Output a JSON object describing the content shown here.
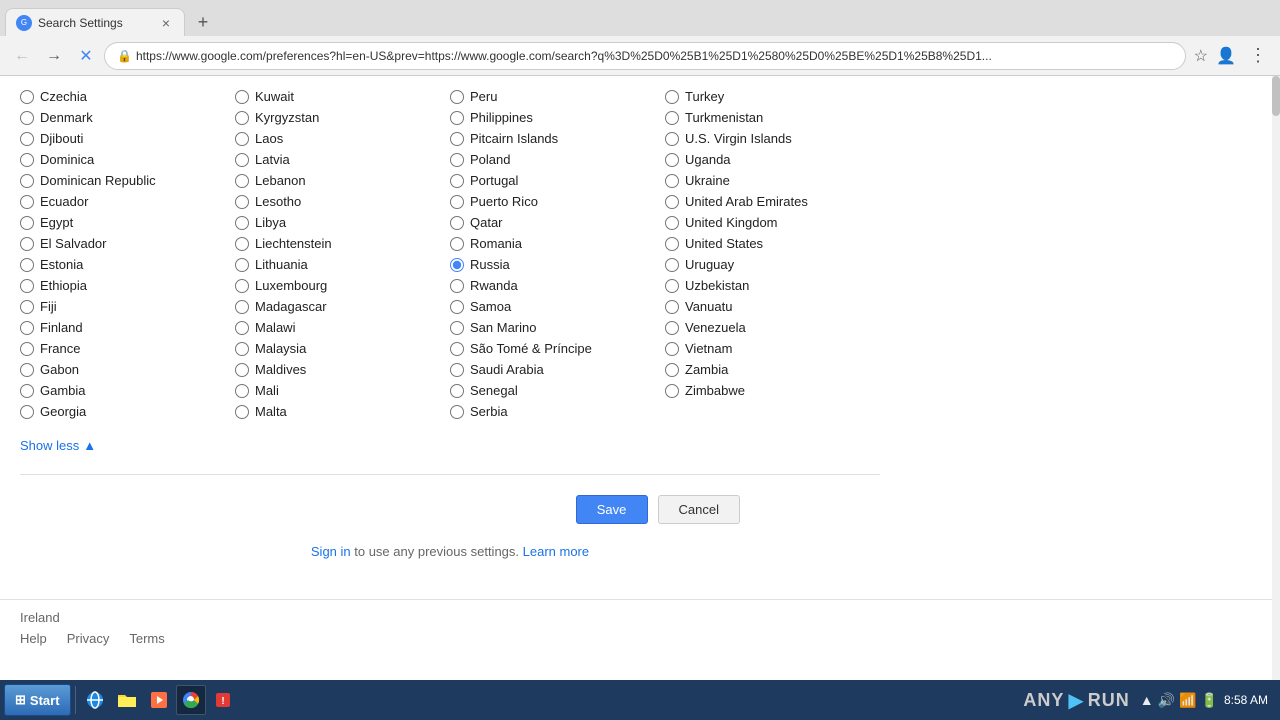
{
  "browser": {
    "tab_title": "Search Settings",
    "url": "https://www.google.com/preferences?hl=en-US&prev=https://www.google.com/search?q%3D%25D0%25B1%25D1%2580%25D0%25BE%25D1%25B8%25D1...",
    "favicon_text": "G"
  },
  "countries": {
    "col1": [
      {
        "id": "czechia",
        "label": "Czechia",
        "checked": false
      },
      {
        "id": "denmark",
        "label": "Denmark",
        "checked": false
      },
      {
        "id": "djibouti",
        "label": "Djibouti",
        "checked": false
      },
      {
        "id": "dominica",
        "label": "Dominica",
        "checked": false
      },
      {
        "id": "dominican_republic",
        "label": "Dominican Republic",
        "checked": false
      },
      {
        "id": "ecuador",
        "label": "Ecuador",
        "checked": false
      },
      {
        "id": "egypt",
        "label": "Egypt",
        "checked": false
      },
      {
        "id": "el_salvador",
        "label": "El Salvador",
        "checked": false
      },
      {
        "id": "estonia",
        "label": "Estonia",
        "checked": false
      },
      {
        "id": "ethiopia",
        "label": "Ethiopia",
        "checked": false
      },
      {
        "id": "fiji",
        "label": "Fiji",
        "checked": false
      },
      {
        "id": "finland",
        "label": "Finland",
        "checked": false
      },
      {
        "id": "france",
        "label": "France",
        "checked": false
      },
      {
        "id": "gabon",
        "label": "Gabon",
        "checked": false
      },
      {
        "id": "gambia",
        "label": "Gambia",
        "checked": false
      },
      {
        "id": "georgia",
        "label": "Georgia",
        "checked": false
      }
    ],
    "col2": [
      {
        "id": "kuwait",
        "label": "Kuwait",
        "checked": false
      },
      {
        "id": "kyrgyzstan",
        "label": "Kyrgyzstan",
        "checked": false
      },
      {
        "id": "laos",
        "label": "Laos",
        "checked": false
      },
      {
        "id": "latvia",
        "label": "Latvia",
        "checked": false
      },
      {
        "id": "lebanon",
        "label": "Lebanon",
        "checked": false
      },
      {
        "id": "lesotho",
        "label": "Lesotho",
        "checked": false
      },
      {
        "id": "libya",
        "label": "Libya",
        "checked": false
      },
      {
        "id": "liechtenstein",
        "label": "Liechtenstein",
        "checked": false
      },
      {
        "id": "lithuania",
        "label": "Lithuania",
        "checked": false
      },
      {
        "id": "luxembourg",
        "label": "Luxembourg",
        "checked": false
      },
      {
        "id": "madagascar",
        "label": "Madagascar",
        "checked": false
      },
      {
        "id": "malawi",
        "label": "Malawi",
        "checked": false
      },
      {
        "id": "malaysia",
        "label": "Malaysia",
        "checked": false
      },
      {
        "id": "maldives",
        "label": "Maldives",
        "checked": false
      },
      {
        "id": "mali",
        "label": "Mali",
        "checked": false
      },
      {
        "id": "malta",
        "label": "Malta",
        "checked": false
      }
    ],
    "col3": [
      {
        "id": "peru",
        "label": "Peru",
        "checked": false
      },
      {
        "id": "philippines",
        "label": "Philippines",
        "checked": false
      },
      {
        "id": "pitcairn_islands",
        "label": "Pitcairn Islands",
        "checked": false
      },
      {
        "id": "poland",
        "label": "Poland",
        "checked": false
      },
      {
        "id": "portugal",
        "label": "Portugal",
        "checked": false
      },
      {
        "id": "puerto_rico",
        "label": "Puerto Rico",
        "checked": false
      },
      {
        "id": "qatar",
        "label": "Qatar",
        "checked": false
      },
      {
        "id": "romania",
        "label": "Romania",
        "checked": false
      },
      {
        "id": "russia",
        "label": "Russia",
        "checked": true
      },
      {
        "id": "rwanda",
        "label": "Rwanda",
        "checked": false
      },
      {
        "id": "samoa",
        "label": "Samoa",
        "checked": false
      },
      {
        "id": "san_marino",
        "label": "San Marino",
        "checked": false
      },
      {
        "id": "sao_tome",
        "label": "São Tomé & Príncipe",
        "checked": false
      },
      {
        "id": "saudi_arabia",
        "label": "Saudi Arabia",
        "checked": false
      },
      {
        "id": "senegal",
        "label": "Senegal",
        "checked": false
      },
      {
        "id": "serbia",
        "label": "Serbia",
        "checked": false
      }
    ],
    "col4": [
      {
        "id": "turkey",
        "label": "Turkey",
        "checked": false
      },
      {
        "id": "turkmenistan",
        "label": "Turkmenistan",
        "checked": false
      },
      {
        "id": "us_virgin_islands",
        "label": "U.S. Virgin Islands",
        "checked": false
      },
      {
        "id": "uganda",
        "label": "Uganda",
        "checked": false
      },
      {
        "id": "ukraine",
        "label": "Ukraine",
        "checked": false
      },
      {
        "id": "uae",
        "label": "United Arab Emirates",
        "checked": false
      },
      {
        "id": "uk",
        "label": "United Kingdom",
        "checked": false
      },
      {
        "id": "us",
        "label": "United States",
        "checked": false
      },
      {
        "id": "uruguay",
        "label": "Uruguay",
        "checked": false
      },
      {
        "id": "uzbekistan",
        "label": "Uzbekistan",
        "checked": false
      },
      {
        "id": "vanuatu",
        "label": "Vanuatu",
        "checked": false
      },
      {
        "id": "venezuela",
        "label": "Venezuela",
        "checked": false
      },
      {
        "id": "vietnam",
        "label": "Vietnam",
        "checked": false
      },
      {
        "id": "zambia",
        "label": "Zambia",
        "checked": false
      },
      {
        "id": "zimbabwe",
        "label": "Zimbabwe",
        "checked": false
      }
    ]
  },
  "show_less_label": "Show less",
  "buttons": {
    "save": "Save",
    "cancel": "Cancel"
  },
  "signin": {
    "prefix": "Sign in",
    "middle": " to use any previous settings. ",
    "learn_more": "Learn more"
  },
  "footer": {
    "region": "Ireland",
    "links": [
      "Help",
      "Privacy",
      "Terms"
    ]
  },
  "taskbar": {
    "start_label": "Start",
    "time": "8:58 AM"
  }
}
